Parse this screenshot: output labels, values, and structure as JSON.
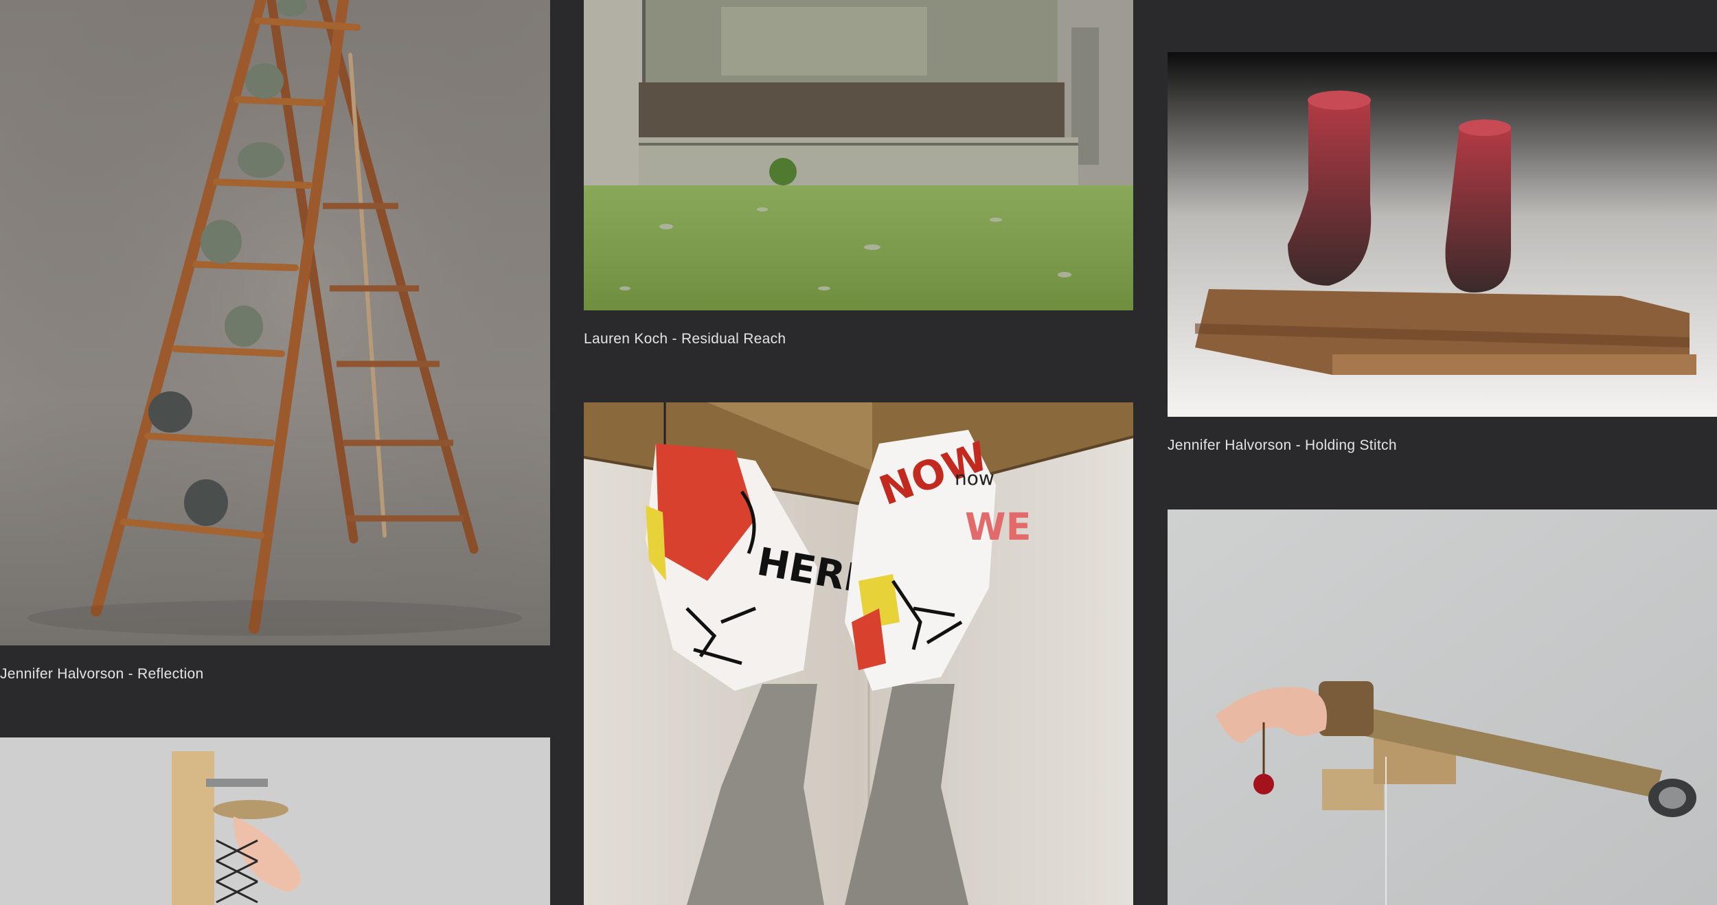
{
  "gallery": {
    "background_color": "#2a292b",
    "caption_color": "#e4e4e6",
    "artworks": [
      {
        "id": "reflection",
        "caption": "Jennifer Halvorson - Reflection",
        "image": "wooden-ladder-with-cast-foot-sculptures"
      },
      {
        "id": "residual-reach",
        "caption": "Lauren Koch - Residual Reach",
        "image": "ruined-concrete-wall-over-grass"
      },
      {
        "id": "holding-stitch",
        "caption": "Jennifer Halvorson - Holding Stitch",
        "image": "red-cast-socks-on-wooden-planks"
      },
      {
        "id": "graffiti-forms",
        "caption": "",
        "image": "two-painted-boulder-forms-on-metal-pedestals",
        "visible_painted_text": [
          "HERE",
          "NOW",
          "WE",
          "now"
        ]
      },
      {
        "id": "hand-cherry",
        "caption": "",
        "image": "prosthetic-hand-on-wooden-arm-holding-cherry"
      },
      {
        "id": "hand-scissor",
        "caption": "",
        "image": "hand-on-scissor-lift-mounted-to-wooden-post"
      }
    ]
  }
}
